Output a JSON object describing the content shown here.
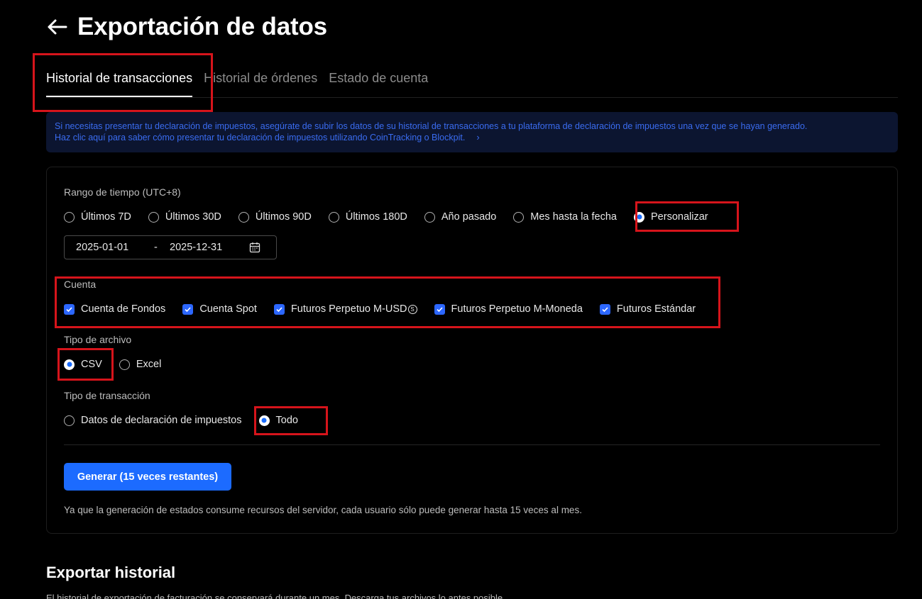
{
  "header": {
    "title": "Exportación de datos",
    "back_icon": "arrow-left-icon"
  },
  "tabs": [
    {
      "label": "Historial de transacciones",
      "active": true
    },
    {
      "label": "Historial de órdenes",
      "active": false
    },
    {
      "label": "Estado de cuenta",
      "active": false
    }
  ],
  "notice": {
    "line1": "Si necesitas presentar tu declaración de impuestos, asegúrate de subir los datos de su historial de transacciones a tu plataforma de declaración de impuestos una vez que se hayan generado.",
    "line2": "Haz clic aquí para saber cómo presentar tu declaración de impuestos utilizando CoinTracking o Blockpit.",
    "chevron": "›"
  },
  "time_range": {
    "label": "Rango de tiempo",
    "tz": "(UTC+8)",
    "options": [
      {
        "label": "Últimos 7D",
        "selected": false
      },
      {
        "label": "Últimos 30D",
        "selected": false
      },
      {
        "label": "Últimos 90D",
        "selected": false
      },
      {
        "label": "Últimos 180D",
        "selected": false
      },
      {
        "label": "Año pasado",
        "selected": false
      },
      {
        "label": "Mes hasta la fecha",
        "selected": false
      },
      {
        "label": "Personalizar",
        "selected": true
      }
    ],
    "start_date": "2025-01-01",
    "separator": "-",
    "end_date": "2025-12-31",
    "calendar_icon": "calendar-icon"
  },
  "account": {
    "label": "Cuenta",
    "options": [
      {
        "label": "Cuenta de Fondos",
        "checked": true
      },
      {
        "label": "Cuenta Spot",
        "checked": true
      },
      {
        "label": "Futuros Perpetuo M-USD",
        "checked": true
      },
      {
        "label": "Futuros Perpetuo M-Moneda",
        "checked": true
      },
      {
        "label": "Futuros Estándar",
        "checked": true
      }
    ],
    "coin_glyph": "S"
  },
  "file_type": {
    "label": "Tipo de archivo",
    "options": [
      {
        "label": "CSV",
        "selected": true
      },
      {
        "label": "Excel",
        "selected": false
      }
    ]
  },
  "tx_type": {
    "label": "Tipo de transacción",
    "options": [
      {
        "label": "Datos de declaración de impuestos",
        "selected": false
      },
      {
        "label": "Todo",
        "selected": true
      }
    ]
  },
  "generate": {
    "button_label": "Generar (15 veces restantes)",
    "note": "Ya que la generación de estados consume recursos del servidor, cada usuario sólo puede generar hasta 15 veces al mes."
  },
  "export_history": {
    "title": "Exportar historial",
    "subtitle": "El historial de exportación de facturación se conservará durante un mes. Descarga tus archivos lo antes posible."
  },
  "colors": {
    "accent": "#1c6bff",
    "highlight": "#d6141b",
    "notice_bg": "#0c1530",
    "notice_text": "#3a6cf0"
  }
}
